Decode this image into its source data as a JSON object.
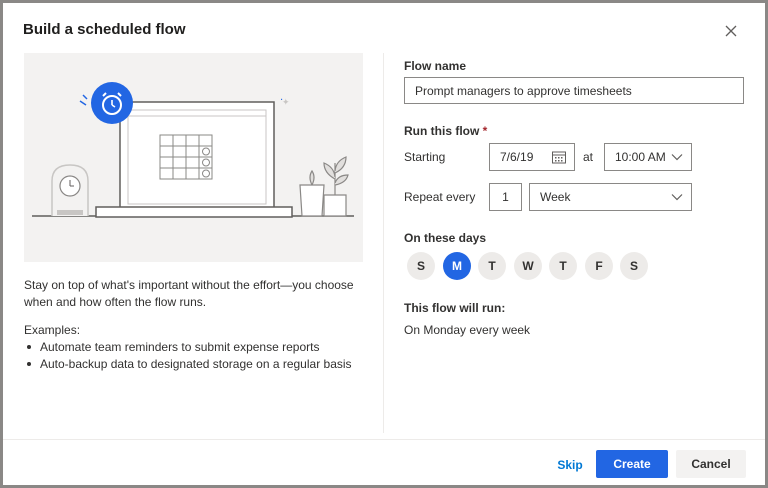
{
  "dialog": {
    "title": "Build a scheduled flow",
    "close_icon": "close-icon"
  },
  "left": {
    "illustration_icon": "alarm-clock-icon",
    "description": "Stay on top of what's important without the effort—you choose when and how often the flow runs.",
    "examples_title": "Examples:",
    "examples": [
      "Automate team reminders to submit expense reports",
      "Auto-backup data to designated storage on a regular basis"
    ]
  },
  "form": {
    "flow_name_label": "Flow name",
    "flow_name_value": "Prompt managers to approve timesheets",
    "run_label": "Run this flow",
    "required_mark": "*",
    "starting_label": "Starting",
    "start_date": "7/6/19",
    "at_label": "at",
    "start_time": "10:00 AM",
    "repeat_label": "Repeat every",
    "repeat_interval": "1",
    "repeat_unit": "Week",
    "days_label": "On these days",
    "days": [
      {
        "label": "S",
        "selected": false
      },
      {
        "label": "M",
        "selected": true
      },
      {
        "label": "T",
        "selected": false
      },
      {
        "label": "W",
        "selected": false
      },
      {
        "label": "T",
        "selected": false
      },
      {
        "label": "F",
        "selected": false
      },
      {
        "label": "S",
        "selected": false
      }
    ],
    "summary_label": "This flow will run:",
    "summary_value": "On Monday every week"
  },
  "footer": {
    "skip_label": "Skip",
    "create_label": "Create",
    "cancel_label": "Cancel"
  },
  "colors": {
    "accent": "#2266e3",
    "link": "#0078d4",
    "required": "#a4262c"
  }
}
